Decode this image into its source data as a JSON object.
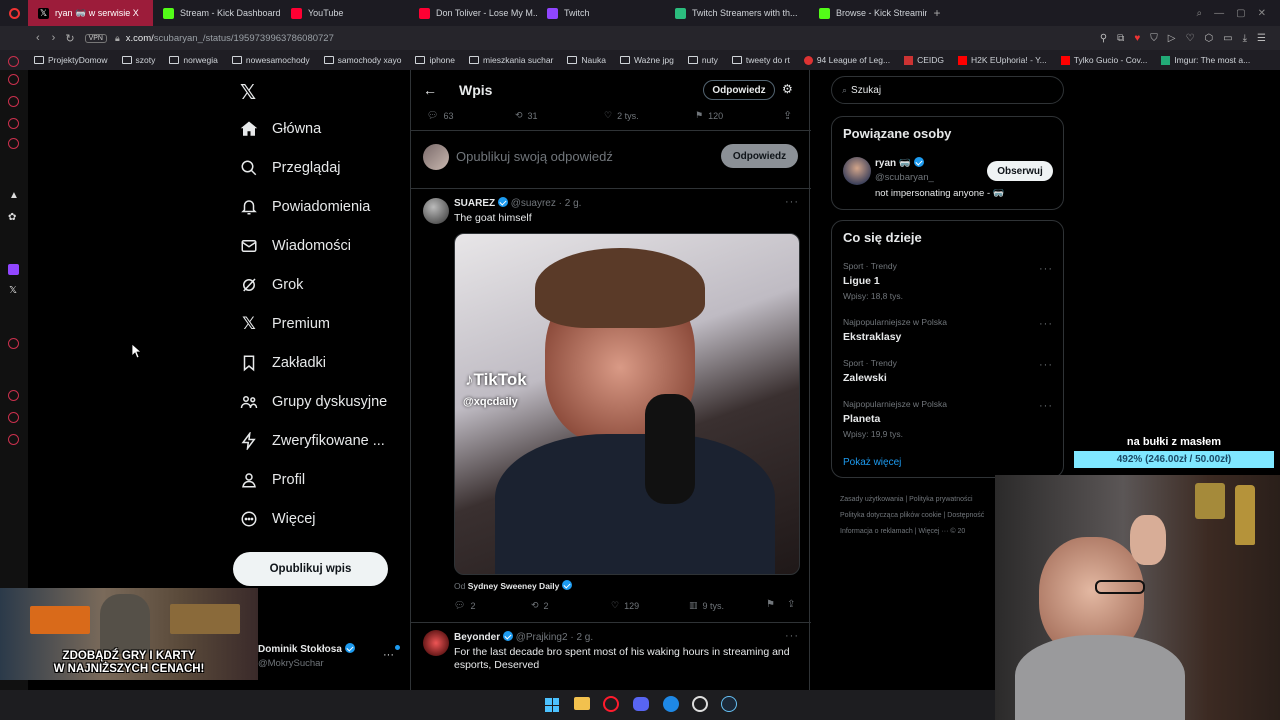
{
  "browser": {
    "tabs": [
      {
        "label": "ryan 🥽 w serwisie X",
        "active": true,
        "favicon": "x-icon"
      },
      {
        "label": "Stream - Kick Dashboard",
        "active": false,
        "favicon": "kick-icon"
      },
      {
        "label": "YouTube",
        "active": false,
        "favicon": "youtube-icon"
      },
      {
        "label": "Don Toliver - Lose My M...",
        "active": false,
        "favicon": "youtube-icon"
      },
      {
        "label": "Twitch",
        "active": false,
        "favicon": "twitch-icon"
      },
      {
        "label": "Twitch Streamers with th...",
        "active": false,
        "favicon": "tt-icon"
      },
      {
        "label": "Browse - Kick Streaming",
        "active": false,
        "favicon": "kick-icon"
      }
    ],
    "new_tab": "+",
    "vpn_label": "VPN",
    "url_host": "x.com/",
    "url_path": "scubaryan_/status/1959739963786080727",
    "bookmarks": [
      "ProjektyDomow",
      "szoty",
      "norwegia",
      "nowesamochody",
      "samochody xayo",
      "iphone",
      "mieszkania suchar",
      "Nauka",
      "Ważne jpg",
      "nuty",
      "tweety do rt",
      "94 League of Leg...",
      "CEIDG",
      "H2K EUphoria! - Y...",
      "Tylko Gucio - Cov...",
      "Imgur: The most a..."
    ]
  },
  "nav": {
    "items": [
      {
        "label": "Główna",
        "icon": "home-icon"
      },
      {
        "label": "Przeglądaj",
        "icon": "search-icon"
      },
      {
        "label": "Powiadomienia",
        "icon": "bell-icon"
      },
      {
        "label": "Wiadomości",
        "icon": "mail-icon"
      },
      {
        "label": "Grok",
        "icon": "grok-icon"
      },
      {
        "label": "Premium",
        "icon": "x-premium-icon"
      },
      {
        "label": "Zakładki",
        "icon": "bookmark-icon"
      },
      {
        "label": "Grupy dyskusyjne",
        "icon": "communities-icon"
      },
      {
        "label": "Zweryfikowane ...",
        "icon": "lightning-icon"
      },
      {
        "label": "Profil",
        "icon": "person-icon"
      },
      {
        "label": "Więcej",
        "icon": "more-circle-icon"
      }
    ],
    "post_button": "Opublikuj wpis",
    "account_name": "Dominik Stokłosa",
    "account_handle": "@MokrySuchar"
  },
  "feed": {
    "header_title": "Wpis",
    "reply_pill": "Odpowiedz",
    "stats_top": {
      "replies": "63",
      "reposts": "31",
      "likes": "2 tys.",
      "bookmarks": "120"
    },
    "compose_placeholder": "Opublikuj swoją odpowiedź",
    "compose_button": "Odpowiedz",
    "reply1": {
      "name": "SUAREZ",
      "handle": "@suayrez",
      "time": "2 g.",
      "text": "The goat himself",
      "tiktok_label": "TikTok",
      "tiktok_handle": "@xqcdaily",
      "from_prefix": "Od",
      "from_source": "Sydney Sweeney Daily",
      "stats": {
        "replies": "2",
        "reposts": "2",
        "likes": "129",
        "views": "9 tys."
      }
    },
    "reply2": {
      "name": "Beyonder",
      "handle": "@Prajking2",
      "time": "2 g.",
      "text": "For the last decade bro spent most of his waking hours in streaming and esports, Deserved"
    }
  },
  "right": {
    "search_placeholder": "Szukaj",
    "related_title": "Powiązane osoby",
    "related_person": {
      "name": "ryan 🥽",
      "handle": "@scubaryan_",
      "bio": "not impersonating anyone - 🥽",
      "follow": "Obserwuj"
    },
    "trends_title": "Co się dzieje",
    "trends": [
      {
        "category": "Sport · Trendy",
        "name": "Ligue 1",
        "count": "Wpisy: 18,8 tys."
      },
      {
        "category": "Najpopularniejsze w Polska",
        "name": "Ekstraklasy",
        "count": ""
      },
      {
        "category": "Sport · Trendy",
        "name": "Zalewski",
        "count": ""
      },
      {
        "category": "Najpopularniejsze w Polska",
        "name": "Planeta",
        "count": "Wpisy: 19,9 tys."
      }
    ],
    "show_more": "Pokaż więcej",
    "footer": [
      "Zasady użytkowania",
      "Polityka prywatności",
      "Polityka dotycząca plików cookie",
      "Dostępność",
      "Informacja o reklamach",
      "Więcej ···",
      "© 20"
    ]
  },
  "overlay": {
    "goal_title": "na bułki z masłem",
    "goal_text": "492% (246.00zł / 50.00zł)",
    "goal_progress": 1.0,
    "ad_line1": "ZDOBĄDŹ GRY I KARTY",
    "ad_line2": "W NAJNIŻSZYCH CENACH!"
  },
  "colors": {
    "accent_blue": "#1d9bf0",
    "active_tab": "#9c1c3a",
    "goal_bar": "#7fe7ff"
  }
}
